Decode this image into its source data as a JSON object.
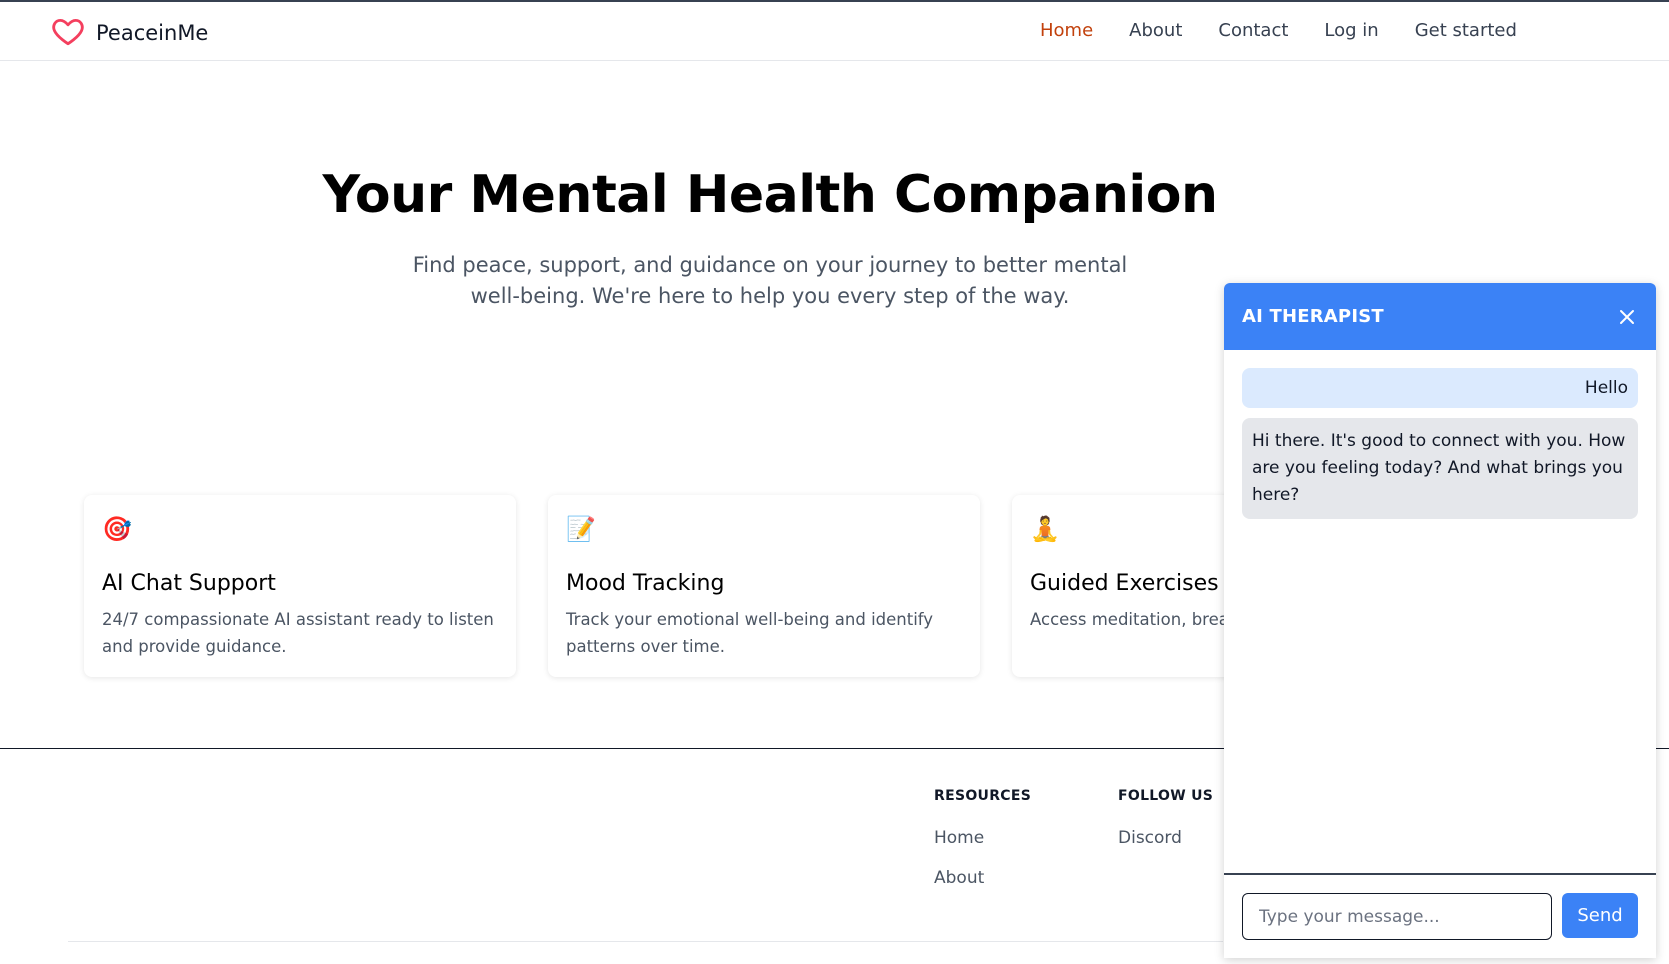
{
  "brand": {
    "name": "PeaceinMe",
    "logo_icon": "heart-outline-icon",
    "accent": "#f43f5e"
  },
  "nav": {
    "items": [
      {
        "label": "Home",
        "active": true
      },
      {
        "label": "About"
      },
      {
        "label": "Contact"
      },
      {
        "label": "Log in"
      },
      {
        "label": "Get started"
      }
    ],
    "active_color": "#c2410c"
  },
  "hero": {
    "title": "Your Mental Health Companion",
    "subtitle": "Find peace, support, and guidance on your journey to better mental well-being. We're here to help you every step of the way."
  },
  "features": [
    {
      "icon": "target-dart-icon",
      "emoji": "🎯",
      "title": "AI Chat Support",
      "desc": "24/7 compassionate AI assistant ready to listen and provide guidance."
    },
    {
      "icon": "memo-pencil-icon",
      "emoji": "📝",
      "title": "Mood Tracking",
      "desc": "Track your emotional well-being and identify patterns over time."
    },
    {
      "icon": "meditation-person-icon",
      "emoji": "🧘",
      "title": "Guided Exercises",
      "desc": "Access meditation, brea relaxation techniques."
    }
  ],
  "footer": {
    "resources": {
      "heading": "RESOURCES",
      "links": [
        "Home",
        "About"
      ]
    },
    "follow": {
      "heading": "FOLLOW US",
      "links": [
        "Discord"
      ]
    }
  },
  "chat": {
    "title": "AI THERAPIST",
    "header_color": "#3b82f6",
    "messages": [
      {
        "role": "user",
        "text": "Hello"
      },
      {
        "role": "assistant",
        "text": "Hi there. It's good to connect with you. How are you feeling today? And what brings you here?"
      }
    ],
    "input": {
      "value": "",
      "placeholder": "Type your message..."
    },
    "send_label": "Send"
  }
}
